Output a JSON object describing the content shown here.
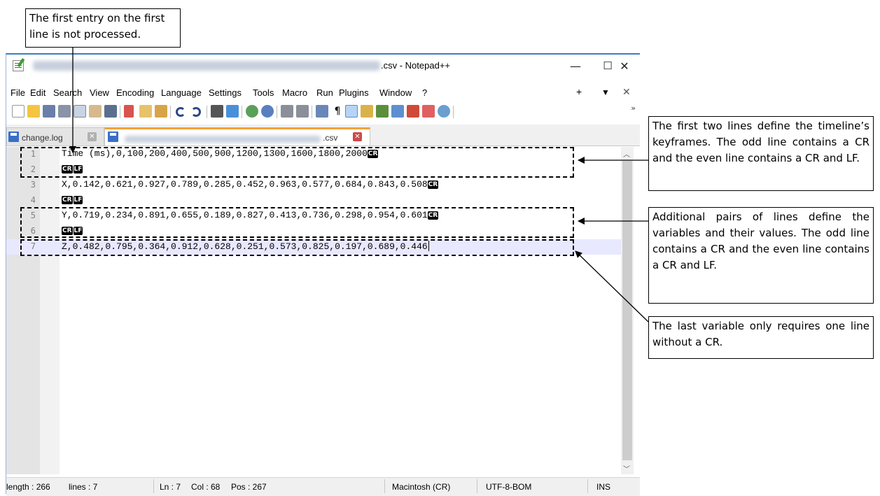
{
  "window": {
    "title_suffix": ".csv - Notepad++",
    "minimize_glyph": "—",
    "maximize_glyph": "☐",
    "close_glyph": "✕"
  },
  "menu": {
    "items": [
      "File",
      "Edit",
      "Search",
      "View",
      "Encoding",
      "Language",
      "Settings",
      "Tools",
      "Macro",
      "Run",
      "Plugins",
      "Window",
      "?"
    ],
    "right": [
      "+",
      "▼",
      "✕"
    ]
  },
  "toolbar": {
    "icons": [
      "new-file-icon",
      "open-file-icon",
      "save-icon",
      "save-all-icon",
      "close-icon",
      "close-all-icon",
      "print-icon",
      "cut-icon",
      "copy-icon",
      "paste-icon",
      "undo-icon",
      "redo-icon",
      "find-icon",
      "replace-icon",
      "zoom-in-icon",
      "zoom-out-icon",
      "sync-vertical-icon",
      "sync-horizontal-icon",
      "word-wrap-icon",
      "show-all-chars-icon",
      "indent-guide-icon",
      "udl-icon",
      "doc-map-icon",
      "doc-list-icon",
      "function-list-icon",
      "folder-workspace-icon",
      "monitoring-icon"
    ],
    "more": "»"
  },
  "tabs": [
    {
      "name": "change.log",
      "close": "✕",
      "active": false
    },
    {
      "name": ".csv",
      "close": "✕",
      "active": true
    }
  ],
  "editor": {
    "lines": [
      {
        "num": "1",
        "text": "Time (ms),0,100,200,400,500,900,1200,1300,1600,1800,2000",
        "eol": [
          "CR"
        ]
      },
      {
        "num": "2",
        "text": "",
        "eol": [
          "CR",
          "LF"
        ]
      },
      {
        "num": "3",
        "text": "X,0.142,0.621,0.927,0.789,0.285,0.452,0.963,0.577,0.684,0.843,0.508",
        "eol": [
          "CR"
        ]
      },
      {
        "num": "4",
        "text": "",
        "eol": [
          "CR",
          "LF"
        ]
      },
      {
        "num": "5",
        "text": "Y,0.719,0.234,0.891,0.655,0.189,0.827,0.413,0.736,0.298,0.954,0.601",
        "eol": [
          "CR"
        ]
      },
      {
        "num": "6",
        "text": "",
        "eol": [
          "CR",
          "LF"
        ]
      },
      {
        "num": "7",
        "text": "Z,0.482,0.795,0.364,0.912,0.628,0.251,0.573,0.825,0.197,0.689,0.446",
        "eol": []
      }
    ]
  },
  "status": {
    "length": "length : 266",
    "lines": "lines : 7",
    "ln": "Ln : 7",
    "col": "Col : 68",
    "pos": "Pos : 267",
    "eol_mode": "Macintosh (CR)",
    "encoding": "UTF-8-BOM",
    "ins": "INS"
  },
  "annotations": {
    "top": "The first entry on the first line is not processed.",
    "keyframes": "The first two lines define the timeline’s keyframes. The odd line contains a CR and the even line contains a CR and LF.",
    "variables": "Additional pairs of lines define the variables and their values. The odd line contains a CR and the even line contains a CR and LF.",
    "last": "The last variable only requires one line without a CR."
  }
}
